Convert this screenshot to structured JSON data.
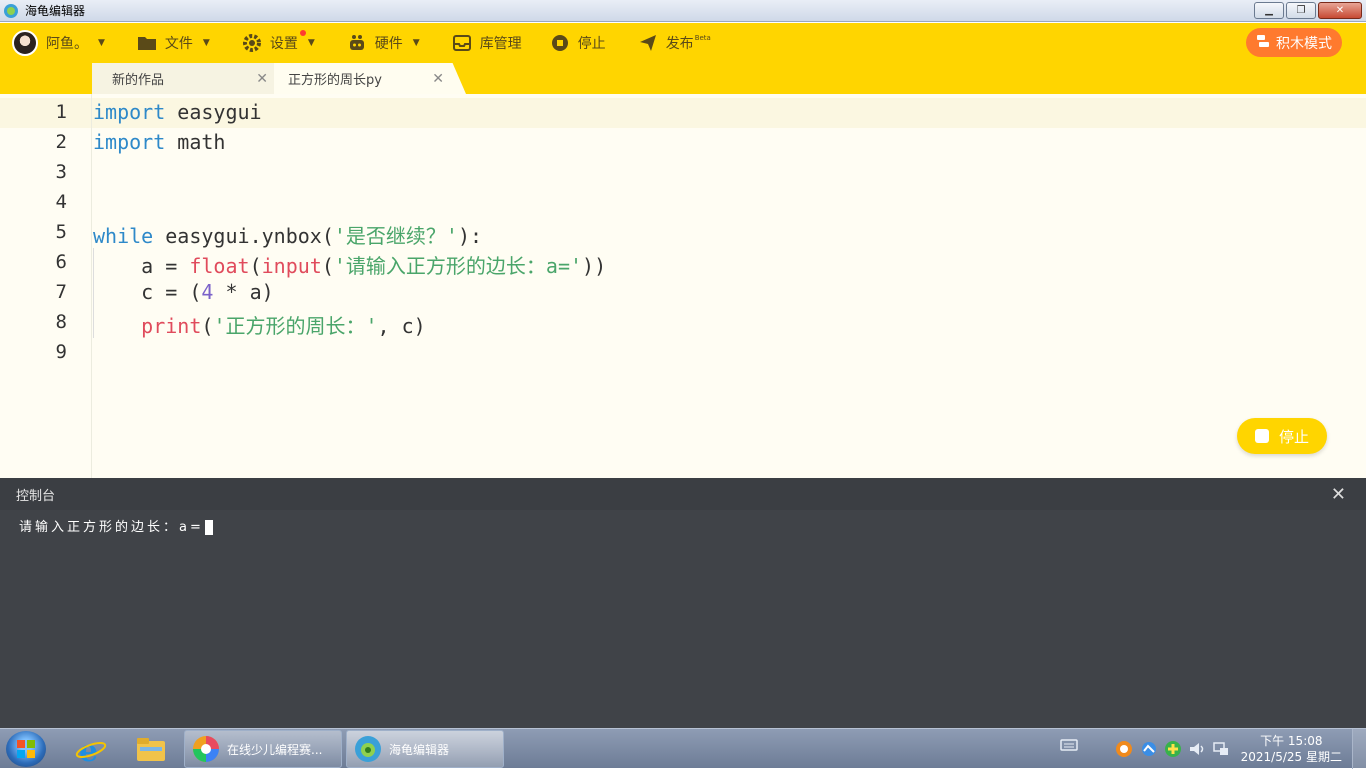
{
  "window": {
    "title": "海龟编辑器",
    "minimize_glyph": "▁",
    "restore_glyph": "❐",
    "close_glyph": "✕"
  },
  "toolbar": {
    "user_name": "阿鱼。",
    "file_label": "文件",
    "settings_label": "设置",
    "hardware_label": "硬件",
    "library_label": "库管理",
    "stop_label": "停止",
    "publish_label": "发布",
    "publish_badge": "Beta",
    "block_mode_label": "积木模式",
    "caret": "▼"
  },
  "tabs": [
    {
      "label": "新的作品",
      "close": "✕"
    },
    {
      "label": "正方形的周长py",
      "close": "✕"
    }
  ],
  "editor": {
    "line_numbers": [
      "1",
      "2",
      "3",
      "4",
      "5",
      "6",
      "7",
      "8",
      "9"
    ],
    "lines": [
      "import easygui",
      "import math",
      "",
      "",
      "while easygui.ynbox('是否继续？'):",
      "    a = float(input('请输入正方形的边长：a='))",
      "    c = (4 * a)",
      "    print('正方形的周长：', c)",
      ""
    ],
    "stop_button_label": "停止"
  },
  "console": {
    "title": "控制台",
    "close": "✕",
    "output": "请输入正方形的边长：a="
  },
  "taskbar": {
    "tasks": [
      {
        "label": "在线少儿编程赛..."
      },
      {
        "label": "海龟编辑器"
      }
    ],
    "clock_time": "下午 15:08",
    "clock_date": "2021/5/25 星期二"
  },
  "colors": {
    "accent_yellow": "#ffd500",
    "block_mode_orange": "#ff7a2e",
    "keyword_blue": "#2e89c9",
    "builtin_red": "#e04b5c",
    "string_green": "#4aa56a",
    "number_purple": "#7b62c9",
    "console_bg": "#404348"
  }
}
